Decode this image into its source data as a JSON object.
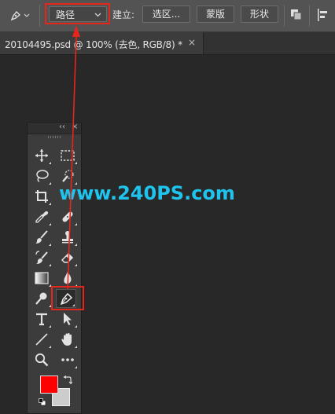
{
  "options_bar": {
    "tool_mode_value": "路径",
    "make_label": "建立:",
    "selection_button": "选区...",
    "mask_button": "蒙版",
    "shape_button": "形状"
  },
  "document_tab": {
    "title": "20104495.psd @ 100% (去色, RGB/8) *",
    "close_glyph": "×"
  },
  "toolbar": {
    "collapse_glyph": "‹‹",
    "close_glyph": "×",
    "tools": [
      "move-tool",
      "marquee-tool",
      "lasso-tool",
      "quick-selection-tool",
      "crop-tool",
      "frame-tool",
      "eyedropper-tool",
      "healing-brush-tool",
      "brush-tool",
      "clone-stamp-tool",
      "history-brush-tool",
      "eraser-tool",
      "gradient-tool",
      "blur-tool",
      "dodge-tool",
      "pen-tool",
      "type-tool",
      "path-selection-tool",
      "line-tool",
      "hand-tool",
      "zoom-tool",
      "more-tools"
    ],
    "active_tool": "pen-tool",
    "foreground_color": "#ff0000",
    "background_color": "#cccccc"
  },
  "watermark": "www.240PS.com",
  "annotation_color": "#e5261b"
}
